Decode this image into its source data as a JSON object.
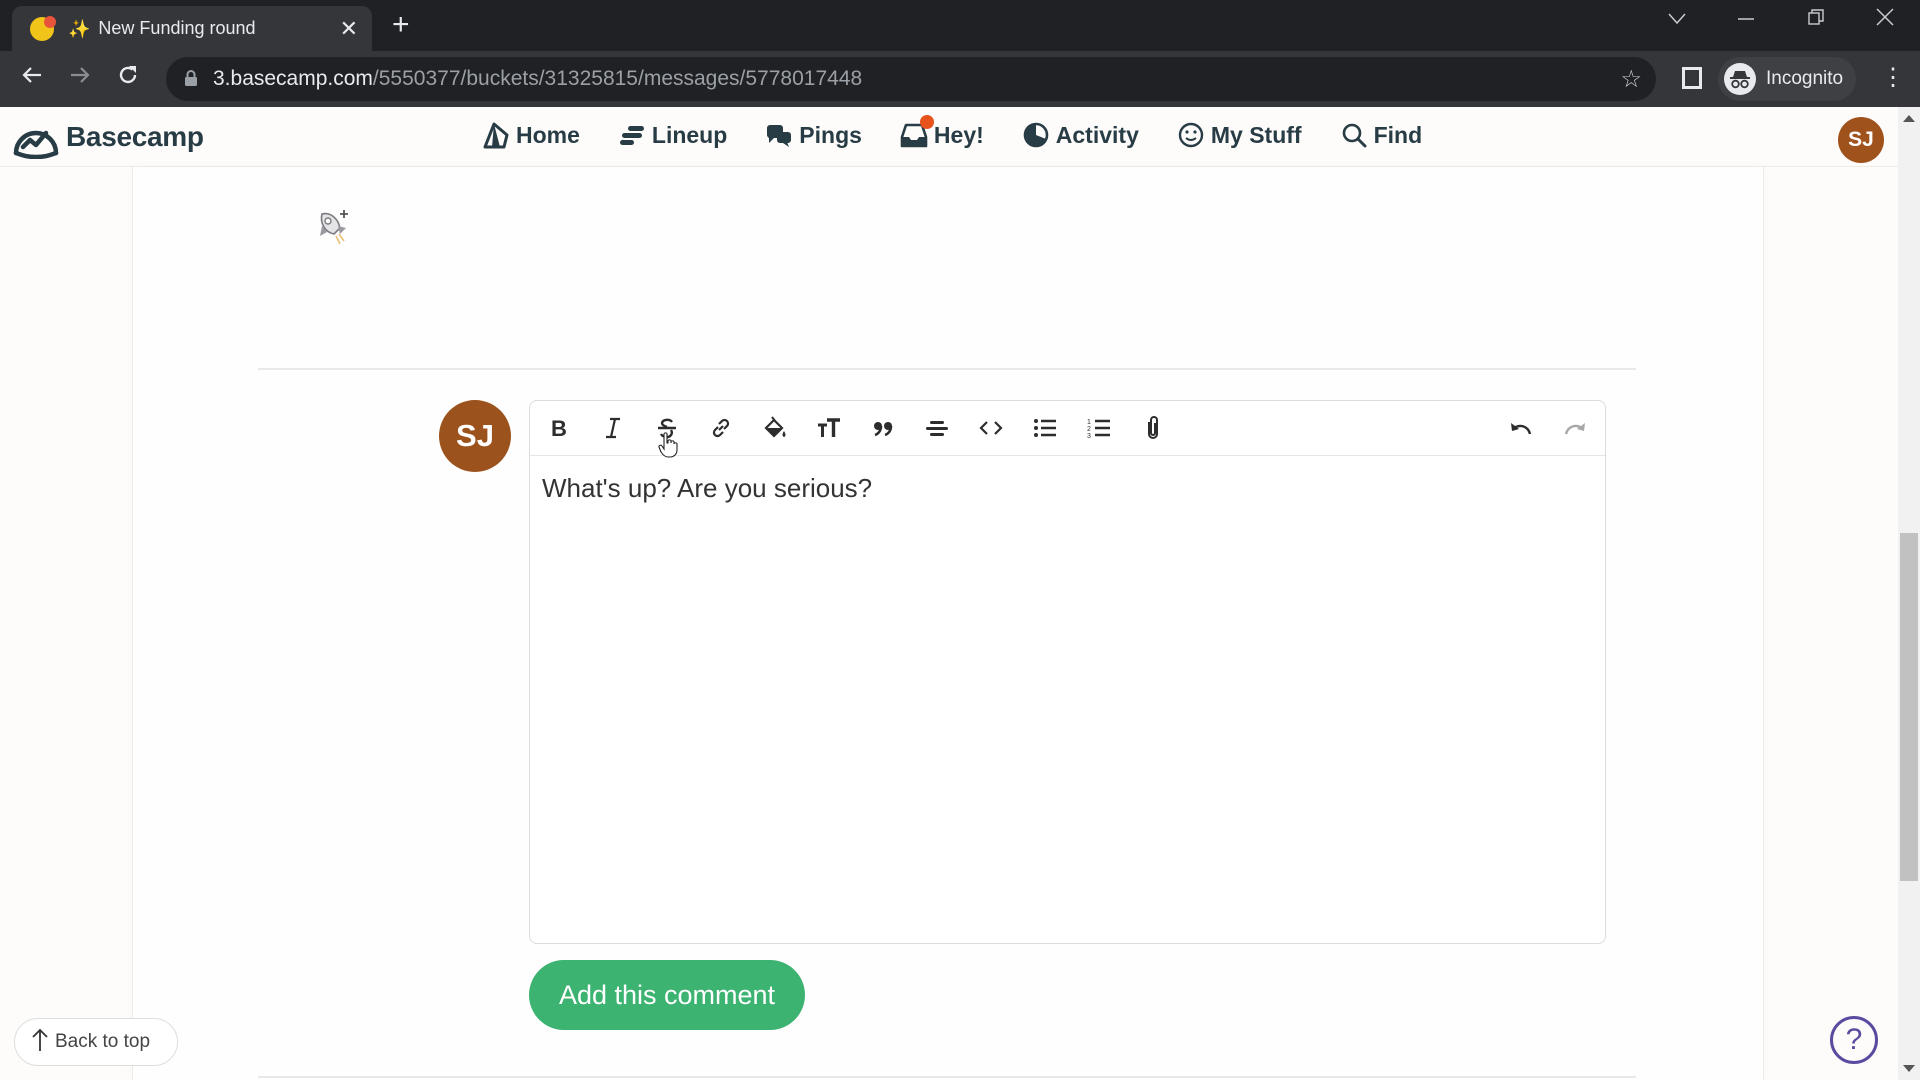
{
  "browser": {
    "tab": {
      "title": "New Funding round",
      "emoji": "✨"
    },
    "url": {
      "host": "3.basecamp.com",
      "path": "/5550377/buckets/31325815/messages/5778017448"
    },
    "profile_label": "Incognito"
  },
  "app": {
    "name": "Basecamp",
    "nav": [
      {
        "label": "Home",
        "icon": "home-icon"
      },
      {
        "label": "Lineup",
        "icon": "lineup-icon"
      },
      {
        "label": "Pings",
        "icon": "pings-icon"
      },
      {
        "label": "Hey!",
        "icon": "hey-inbox-icon",
        "has_notification": true
      },
      {
        "label": "Activity",
        "icon": "activity-icon"
      },
      {
        "label": "My Stuff",
        "icon": "smiley-icon"
      },
      {
        "label": "Find",
        "icon": "search-icon"
      }
    ],
    "user_initials": "SJ",
    "colors": {
      "accent_green": "#3cb371",
      "avatar_brown": "#a0521c",
      "notify_orange": "#e8531c",
      "help_purple": "#5b4aa0",
      "text_dark": "#283c46"
    }
  },
  "comment": {
    "author_initials": "SJ",
    "toolbar": [
      {
        "name": "bold",
        "icon": "bold-icon"
      },
      {
        "name": "italic",
        "icon": "italic-icon"
      },
      {
        "name": "strikethrough",
        "icon": "strikethrough-icon"
      },
      {
        "name": "link",
        "icon": "link-icon"
      },
      {
        "name": "highlight",
        "icon": "paint-bucket-icon"
      },
      {
        "name": "heading",
        "icon": "text-size-icon"
      },
      {
        "name": "quote",
        "icon": "quote-icon"
      },
      {
        "name": "divider",
        "icon": "horizontal-rule-icon"
      },
      {
        "name": "code",
        "icon": "code-icon"
      },
      {
        "name": "bullet-list",
        "icon": "bullet-list-icon"
      },
      {
        "name": "numbered-list",
        "icon": "numbered-list-icon"
      },
      {
        "name": "attach",
        "icon": "paperclip-icon"
      },
      {
        "name": "undo",
        "icon": "undo-icon"
      },
      {
        "name": "redo",
        "icon": "redo-icon",
        "disabled": true
      }
    ],
    "body_text": "What's up? Are you serious?",
    "submit_label": "Add this comment"
  },
  "footer": {
    "back_to_top_label": "Back to top",
    "help_label": "?"
  }
}
